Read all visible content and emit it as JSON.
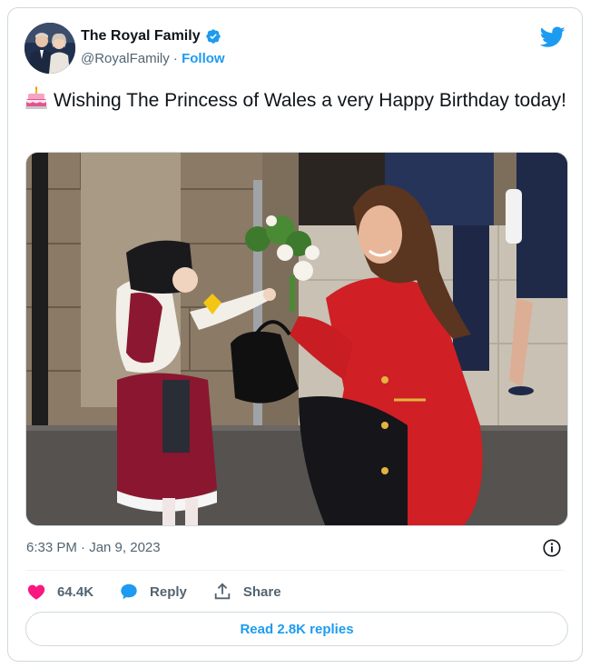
{
  "author": {
    "name": "The Royal Family",
    "handle": "@RoyalFamily",
    "separator": "·",
    "follow_label": "Follow"
  },
  "icons": {
    "avatar": "avatar-photo",
    "verified": "verified-badge-icon",
    "brand": "twitter-bird-icon",
    "emoji": "birthday-cake-icon",
    "info": "info-icon",
    "like": "heart-icon",
    "reply": "reply-bubble-icon",
    "share": "share-icon"
  },
  "tweet": {
    "text": "Wishing The Princess of Wales a very Happy Birthday today!"
  },
  "meta": {
    "timestamp": "6:33 PM · Jan 9, 2023"
  },
  "actions": {
    "likes_count": "64.4K",
    "reply_label": "Reply",
    "share_label": "Share"
  },
  "replies_button": {
    "label": "Read 2.8K replies"
  },
  "colors": {
    "accent": "#1d9bf0",
    "like": "#f91880",
    "text": "#0f1419",
    "muted": "#536471",
    "border": "#cfd9de"
  }
}
